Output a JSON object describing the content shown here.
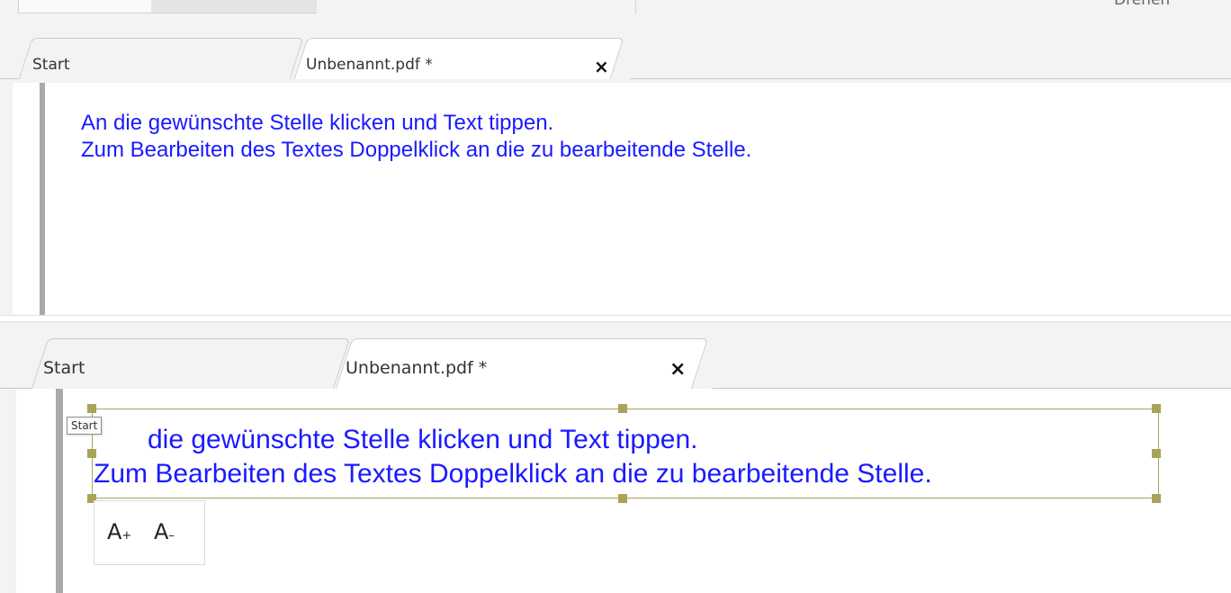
{
  "top_toolbar": {
    "cut_label": "Drehen"
  },
  "panel_top": {
    "tabs": [
      {
        "label": "Start"
      },
      {
        "label": "Unbenannt.pdf *",
        "close_symbol": "×"
      }
    ],
    "document": {
      "line1": "An die gewünschte Stelle klicken und Text tippen.",
      "line2": "Zum Bearbeiten des Textes Doppelklick an die zu bearbeitende Stelle."
    }
  },
  "panel_bottom": {
    "tabs": [
      {
        "label": "Start"
      },
      {
        "label": "Unbenannt.pdf *",
        "close_symbol": "×"
      }
    ],
    "document": {
      "line1_rest": "die gewünschte Stelle klicken und Text tippen.",
      "line2": "Zum Bearbeiten des Textes Doppelklick an die zu bearbeitende Stelle."
    },
    "tooltip": "Start",
    "font_tools": {
      "increase_label": "A",
      "increase_suffix": "+",
      "decrease_label": "A",
      "decrease_suffix": "–"
    }
  },
  "colors": {
    "text_blue": "#1a1aff",
    "selection": "#a9a35a"
  }
}
